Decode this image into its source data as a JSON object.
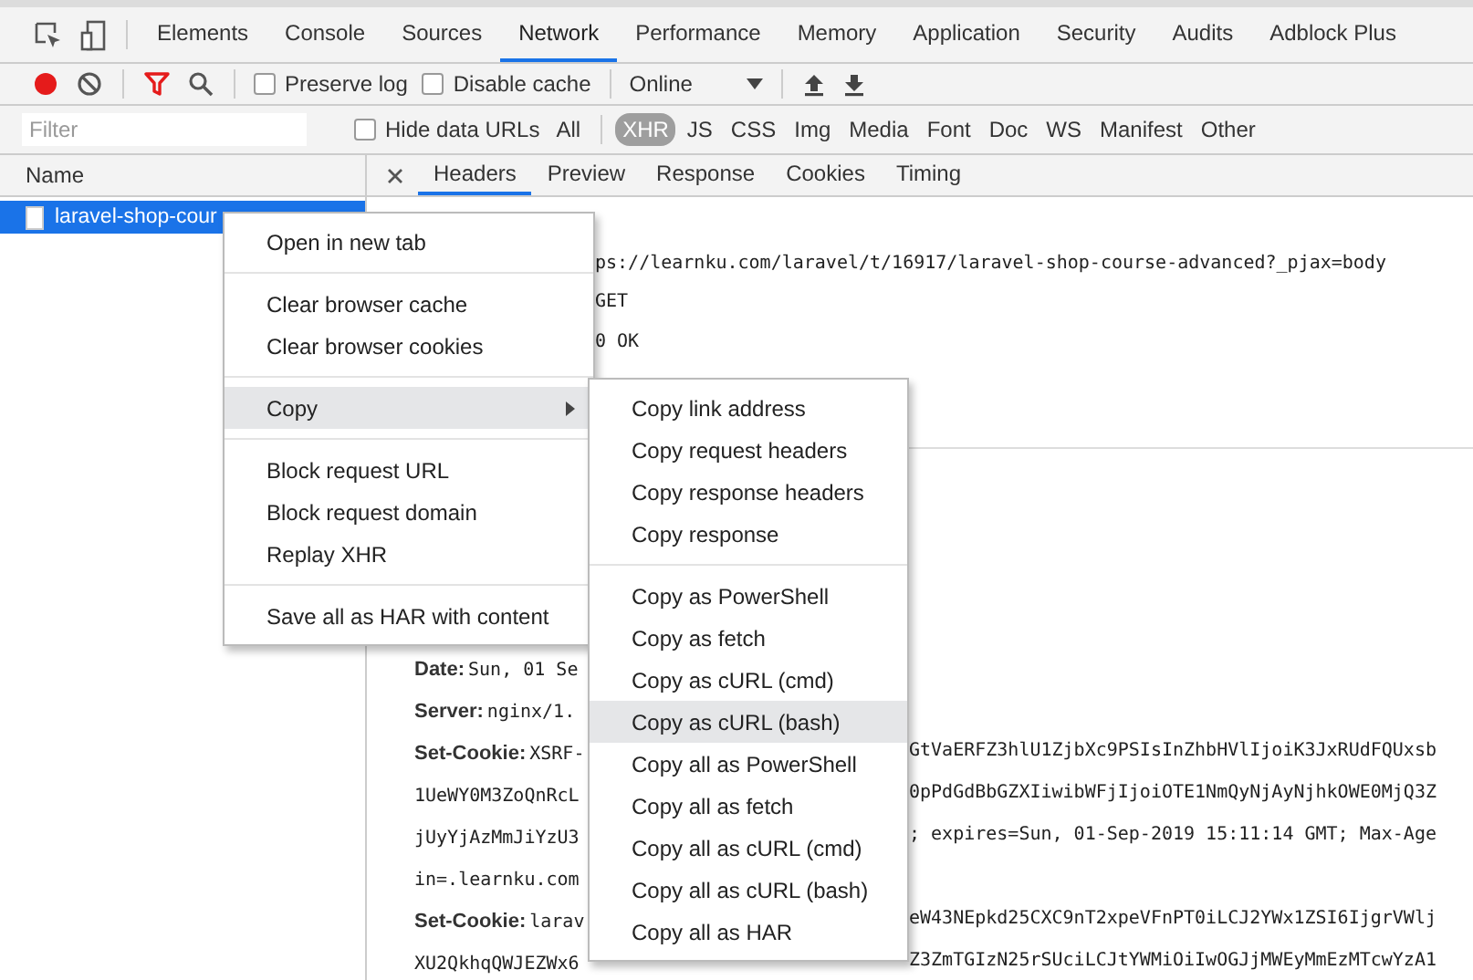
{
  "main_tabs": [
    {
      "label": "Elements",
      "selected": false
    },
    {
      "label": "Console",
      "selected": false
    },
    {
      "label": "Sources",
      "selected": false
    },
    {
      "label": "Network",
      "selected": true
    },
    {
      "label": "Performance",
      "selected": false
    },
    {
      "label": "Memory",
      "selected": false
    },
    {
      "label": "Application",
      "selected": false
    },
    {
      "label": "Security",
      "selected": false
    },
    {
      "label": "Audits",
      "selected": false
    },
    {
      "label": "Adblock Plus",
      "selected": false
    }
  ],
  "toolbar": {
    "recording": true,
    "preserve_log": {
      "label": "Preserve log",
      "checked": false
    },
    "disable_cache": {
      "label": "Disable cache",
      "checked": false
    },
    "throttling": "Online"
  },
  "filter": {
    "placeholder": "Filter",
    "hide_data_urls": {
      "label": "Hide data URLs",
      "checked": false
    },
    "types": [
      {
        "label": "All",
        "selected": false
      },
      {
        "label": "XHR",
        "selected": true
      },
      {
        "label": "JS",
        "selected": false
      },
      {
        "label": "CSS",
        "selected": false
      },
      {
        "label": "Img",
        "selected": false
      },
      {
        "label": "Media",
        "selected": false
      },
      {
        "label": "Font",
        "selected": false
      },
      {
        "label": "Doc",
        "selected": false
      },
      {
        "label": "WS",
        "selected": false
      },
      {
        "label": "Manifest",
        "selected": false
      },
      {
        "label": "Other",
        "selected": false
      }
    ]
  },
  "requests": {
    "column": "Name",
    "rows": [
      {
        "name": "laravel-shop-cour",
        "selected": true
      }
    ]
  },
  "detail_tabs": [
    {
      "label": "Headers",
      "selected": true
    },
    {
      "label": "Preview",
      "selected": false
    },
    {
      "label": "Response",
      "selected": false
    },
    {
      "label": "Cookies",
      "selected": false
    },
    {
      "label": "Timing",
      "selected": false
    }
  ],
  "general_rows": [
    {
      "value": "ps://learnku.com/laravel/t/16917/laravel-shop-course-advanced?_pjax=body"
    },
    {
      "value": "GET"
    },
    {
      "value": "0 OK"
    }
  ],
  "response_header_rows": [
    {
      "name": "Date:",
      "value": "Sun, 01 Se"
    },
    {
      "name": "Server:",
      "value": "nginx/1."
    },
    {
      "name": "Set-Cookie:",
      "value": "XSRF-",
      "value_continued": "GtVaERFZ3hlU1ZjbXc9PSIsInZhbHVlIjoiK3JxRUdFQUxsb"
    },
    {
      "value": "1UeWY0M3ZoQnRcL",
      "value_continued": "0pPdGdBbGZXIiwibWFjIjoiOTE1NmQyNjAyNjhkOWE0MjQ3Z"
    },
    {
      "value": "jUyYjAzMmJiYzU3",
      "value_continued": "; expires=Sun, 01-Sep-2019 15:11:14 GMT; Max-Age"
    },
    {
      "value": "in=.learnku.com"
    },
    {
      "name": "Set-Cookie:",
      "value": "larav",
      "value_continued": "eW43NEpkd25CXC9nT2xpeVFnPT0iLCJ2YWx1ZSI6IjgrVWlj"
    },
    {
      "value": "XU2QkhqQWJEZWx6",
      "value_continued": "Z3ZmTGIzN25rSUciLCJtYWMiOiIwOGJjMWEyMmEzMTcwYzA1"
    }
  ],
  "context_menu": {
    "groups": [
      [
        {
          "label": "Open in new tab",
          "highlighted": false,
          "has_submenu": false
        }
      ],
      [
        {
          "label": "Clear browser cache",
          "highlighted": false,
          "has_submenu": false
        },
        {
          "label": "Clear browser cookies",
          "highlighted": false,
          "has_submenu": false
        }
      ],
      [
        {
          "label": "Copy",
          "highlighted": true,
          "has_submenu": true
        }
      ],
      [
        {
          "label": "Block request URL",
          "highlighted": false,
          "has_submenu": false
        },
        {
          "label": "Block request domain",
          "highlighted": false,
          "has_submenu": false
        },
        {
          "label": "Replay XHR",
          "highlighted": false,
          "has_submenu": false
        }
      ],
      [
        {
          "label": "Save all as HAR with content",
          "highlighted": false,
          "has_submenu": false
        }
      ]
    ]
  },
  "copy_submenu": {
    "groups": [
      [
        {
          "label": "Copy link address",
          "highlighted": false
        },
        {
          "label": "Copy request headers",
          "highlighted": false
        },
        {
          "label": "Copy response headers",
          "highlighted": false
        },
        {
          "label": "Copy response",
          "highlighted": false
        }
      ],
      [
        {
          "label": "Copy as PowerShell",
          "highlighted": false
        },
        {
          "label": "Copy as fetch",
          "highlighted": false
        },
        {
          "label": "Copy as cURL (cmd)",
          "highlighted": false
        },
        {
          "label": "Copy as cURL (bash)",
          "highlighted": true
        },
        {
          "label": "Copy all as PowerShell",
          "highlighted": false
        },
        {
          "label": "Copy all as fetch",
          "highlighted": false
        },
        {
          "label": "Copy all as cURL (cmd)",
          "highlighted": false
        },
        {
          "label": "Copy all as cURL (bash)",
          "highlighted": false
        },
        {
          "label": "Copy all as HAR",
          "highlighted": false
        }
      ]
    ]
  }
}
